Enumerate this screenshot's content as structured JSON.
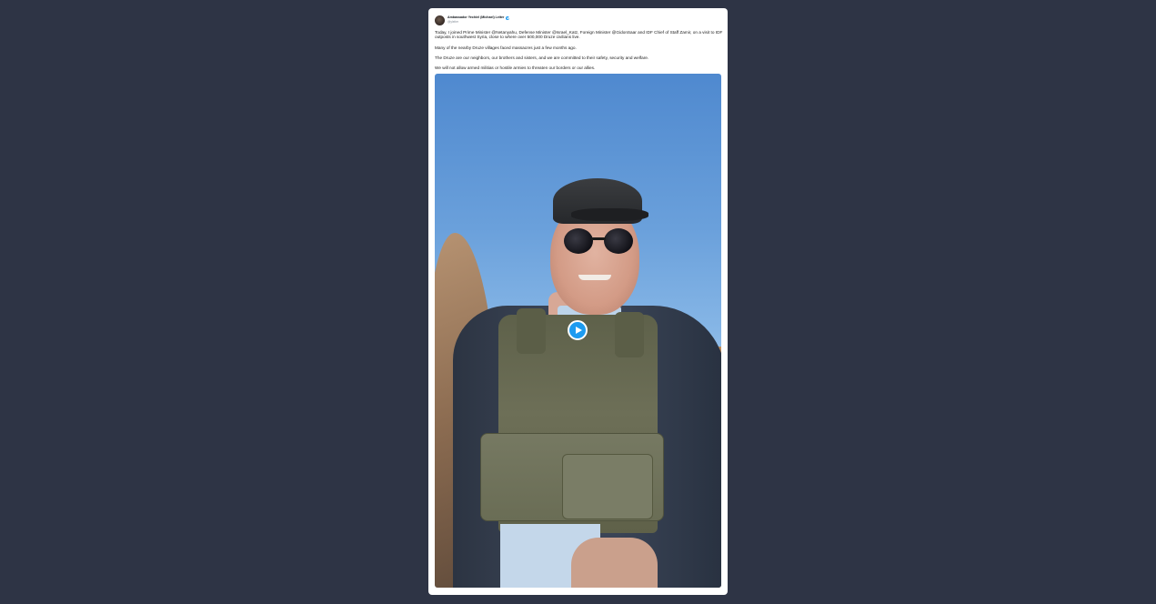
{
  "tweet": {
    "author": {
      "display_name": "Ambassador Yechiel (Michael) Leiter",
      "handle": "@yleiter",
      "verified": true,
      "avatar_icon": "avatar-photo"
    },
    "paragraphs": [
      "Today, I joined Prime Minister @Netanyahu, Defense Minister @Israel_Katz, Foreign Minister @GidonSaar and IDF Chief of Staff Zamir, on a visit to IDF outposts in southwest Syria, close to where over 500,000 Druze civilians live.",
      "Many of the nearby Druze villages faced massacres just a few months ago.",
      "The Druze are our neighbors, our brothers and sisters, and we are committed to their safety, security and welfare.",
      "We will not allow armed militias or hostile armies to threaten our borders or our allies."
    ],
    "media": {
      "type": "video",
      "play_icon": "play-icon"
    }
  },
  "colors": {
    "page_background": "#2e3445",
    "card_background": "#ffffff",
    "accent": "#1d9bf0"
  }
}
